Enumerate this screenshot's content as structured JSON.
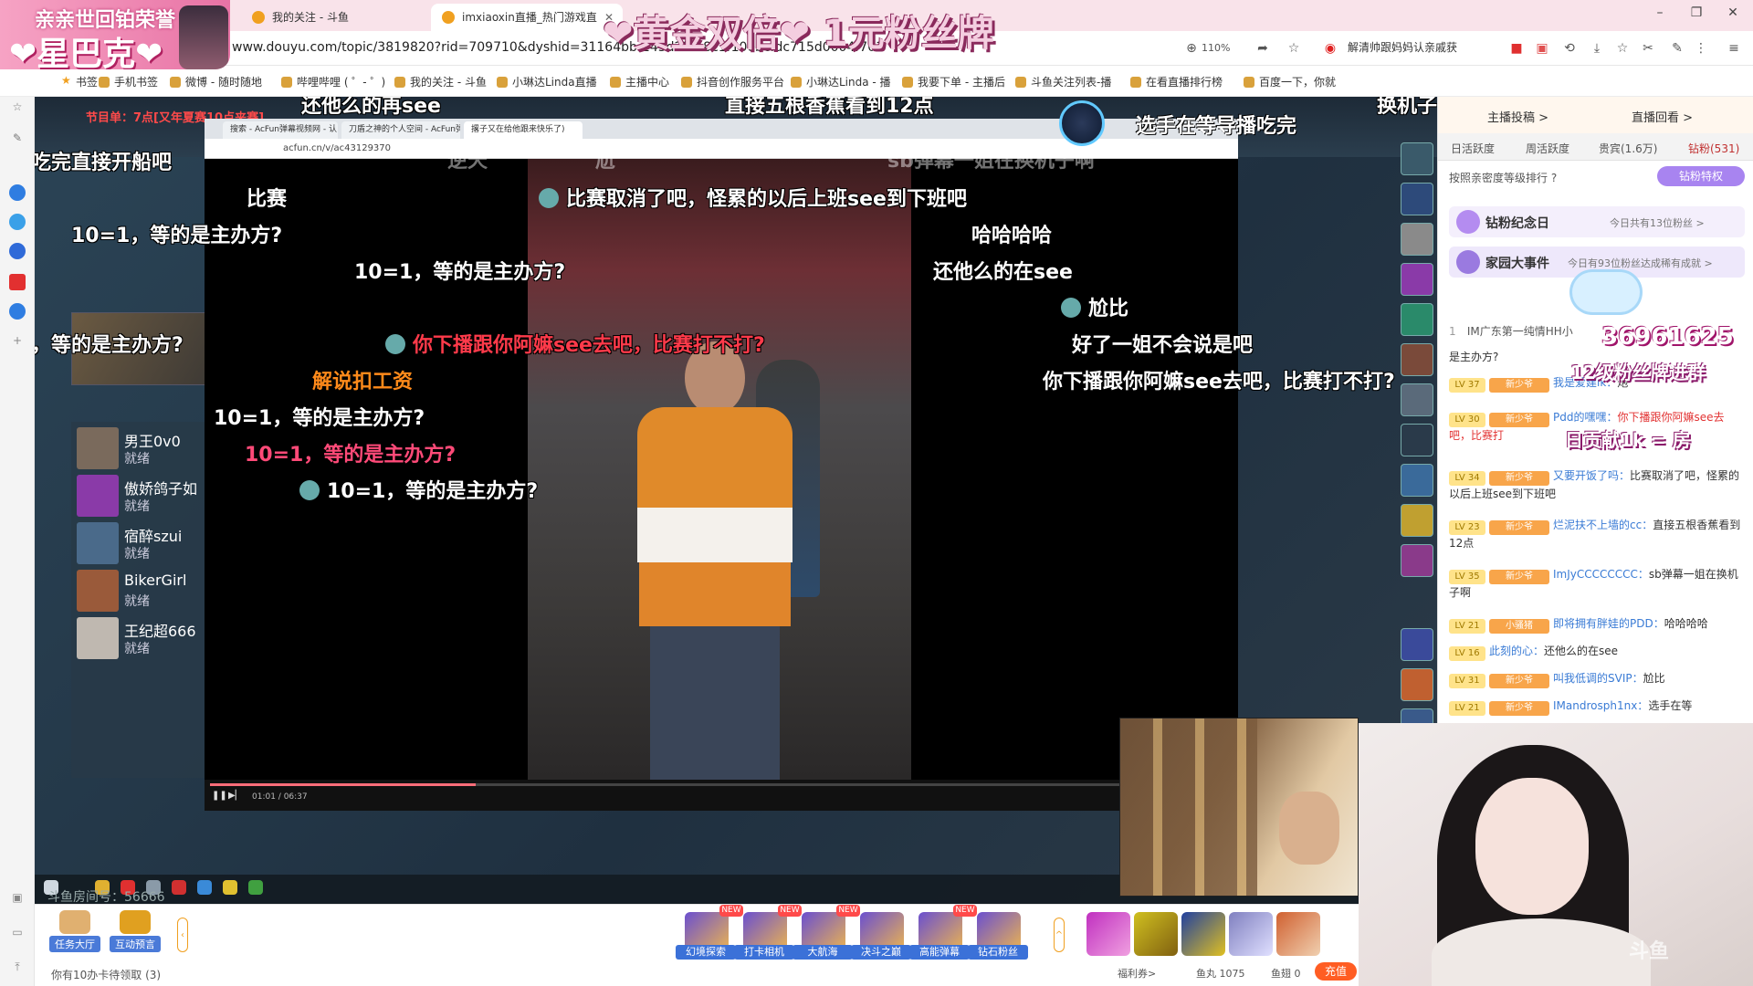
{
  "browser": {
    "tabs": [
      {
        "label": "我的关注 - 斗鱼"
      },
      {
        "label": "imxiaoxin直播_热门游戏直"
      }
    ],
    "url": "www.douyu.com/topic/3819820?rid=709710&dyshid=31164bb-143d2fb18c1f10ebcfdc715d0004f701",
    "zoom": "110%",
    "extension_text": "解清帅跟妈妈认亲戚获",
    "bookmarks": [
      "书签",
      "手机书签",
      "微博 - 随时随地",
      "哔哩哔哩 ( ゜- ゜)",
      "我的关注 - 斗鱼",
      "小琳达Linda直播",
      "主播中心",
      "抖音创作服务平台",
      "小琳达Linda - 播",
      "我要下单 - 主播后",
      "斗鱼关注列表-播",
      "在看直播排行榜",
      "百度一下，你就"
    ]
  },
  "overlay": {
    "banner_sub": "亲亲世回铂荣誉",
    "banner_main": "❤星巴克❤",
    "top_banner": "❤黄金双倍❤  1元粉丝牌"
  },
  "stage": {
    "round_banner": "节目单：7点[又年夏赛10点夹赛]",
    "wait_notice": "选手在等导播吃完",
    "inner_tabs": [
      "搜索 - AcFun弹幕视频网 - 认",
      "刀盾之神的个人空间 - AcFun弹",
      "撂子又在给他跟来快乐了)"
    ],
    "inner_url": "acfun.cn/v/ac43129370",
    "video_time": "01:01 / 06:37",
    "video_progress": 0.26,
    "room_number": "斗鱼房间号：56666",
    "players": [
      {
        "name": "男王0v0",
        "state": "就绪",
        "color": "#7a6a5c"
      },
      {
        "name": "傲娇鸽子如",
        "state": "就绪",
        "color": "#8a3aa8"
      },
      {
        "name": "宿醉szui",
        "state": "就绪",
        "color": "#4a6a8a"
      },
      {
        "name": "BikerGirl",
        "state": "就绪",
        "color": "#9a5a3a"
      },
      {
        "name": "王纪超666",
        "state": "就绪",
        "color": "#bfb8b0"
      }
    ]
  },
  "danmaku": [
    {
      "text": "还他么的再see",
      "style": "normal"
    },
    {
      "text": "直接五根香蕉看到12点",
      "style": "normal"
    },
    {
      "text": "换机子",
      "style": "normal"
    },
    {
      "text": "吃完直接开船吧",
      "style": "normal"
    },
    {
      "text": "逆天",
      "style": "dim"
    },
    {
      "text": "尬",
      "style": "dim"
    },
    {
      "text": "sb弹幕一姐在换机子啊",
      "style": "dim"
    },
    {
      "text": "比赛",
      "style": "normal"
    },
    {
      "text": "比赛取消了吧，怪累的以后上班see到下班吧",
      "style": "normal"
    },
    {
      "text": "10=1，等的是主办方?",
      "style": "normal"
    },
    {
      "text": "哈哈哈哈",
      "style": "normal"
    },
    {
      "text": "10=1，等的是主办方?",
      "style": "normal"
    },
    {
      "text": "还他么的在see",
      "style": "normal"
    },
    {
      "text": "尬比",
      "style": "normal"
    },
    {
      "text": "，等的是主办方?",
      "style": "normal"
    },
    {
      "text": "你下播跟你阿嫲see去吧，比赛打不打?",
      "style": "red"
    },
    {
      "text": "好了一姐不会说是吧",
      "style": "normal"
    },
    {
      "text": "解说扣工资",
      "style": "orange"
    },
    {
      "text": "你下播跟你阿嫲see去吧，比赛打不打?",
      "style": "normal"
    },
    {
      "text": "10=1，等的是主办方?",
      "style": "normal"
    },
    {
      "text": "10=1，等的是主办方?",
      "style": "pink"
    },
    {
      "text": "10=1，等的是主办方?",
      "style": "normal"
    }
  ],
  "chat": {
    "head_links": [
      "主播投稿 >",
      "直播回看 >"
    ],
    "tabs": [
      "日活跃度",
      "周活跃度",
      "贵宾(1.6万)",
      "钻粉(531)"
    ],
    "rank_label": "按照亲密度等级排行 ?",
    "vip_button": "钻粉特权",
    "events": [
      {
        "name": "钻粉纪念日",
        "desc": "今日共有13位粉丝 >"
      },
      {
        "name": "家园大事件",
        "desc": "今日有93位粉丝达成稀有成就 >"
      }
    ],
    "rank_top": {
      "rank": "1",
      "name": "IM广东第一纯情HH小"
    },
    "messages": [
      {
        "lv": "",
        "medal": "",
        "user": "",
        "text": "是主办方?",
        "red": false
      },
      {
        "lv": "LV 37",
        "medal": "新少爷",
        "user": "我是爱建ik：",
        "text": "炮",
        "red": false
      },
      {
        "lv": "LV 30",
        "medal": "新少爷",
        "user": "Pdd的嘿嘿：",
        "text": "你下播跟你阿嫲see去吧，比赛打",
        "red": true
      },
      {
        "lv": "LV 34",
        "medal": "新少爷",
        "user": "又要开饭了吗：",
        "text": "比赛取消了吧，怪累的以后上班see到下班吧",
        "red": false
      },
      {
        "lv": "LV 23",
        "medal": "新少爷",
        "user": "烂泥扶不上墙的cc：",
        "text": "直接五根香蕉看到12点",
        "red": false
      },
      {
        "lv": "LV 35",
        "medal": "新少爷",
        "user": "ImJyCCCCCCCC：",
        "text": "sb弹幕一姐在换机子啊",
        "red": false
      },
      {
        "lv": "LV 21",
        "medal": "小骚猪",
        "user": "即将拥有胖娃的PDD：",
        "text": "哈哈哈哈",
        "red": false
      },
      {
        "lv": "LV 16",
        "medal": "",
        "user": "此刻的心：",
        "text": "还他么的在see",
        "red": false
      },
      {
        "lv": "LV 31",
        "medal": "新少爷",
        "user": "叫我低调的SVIP：",
        "text": "尬比",
        "red": false
      },
      {
        "lv": "LV 21",
        "medal": "新少爷",
        "user": "IMandrosph1nx：",
        "text": "选手在等",
        "red": false
      }
    ],
    "fan_count": "36961625",
    "fan_level": "12级粉丝牌进群",
    "fan_contrib": "日贡献1k = 房"
  },
  "giftbar": {
    "left_buttons": [
      "任务大厅",
      "互动预言"
    ],
    "gifts": [
      {
        "label": "幻境探索",
        "new": true
      },
      {
        "label": "打卡相机",
        "new": true
      },
      {
        "label": "大航海",
        "new": true
      },
      {
        "label": "决斗之巅",
        "new": false
      },
      {
        "label": "高能弹幕",
        "new": true
      },
      {
        "label": "钻石粉丝",
        "new": false
      }
    ],
    "new_tag": "NEW",
    "cards": "你有10办卡待领取 (3)",
    "welfare": "福利券>",
    "fish_ball": "鱼丸 1075",
    "fish_fin": "鱼翅 0",
    "recharge": "充值"
  },
  "watermark": "斗鱼",
  "colors": {
    "accent": "#ff5d23",
    "chat_link": "#3a7bd5",
    "danmaku_red": "#ff3a4a"
  }
}
